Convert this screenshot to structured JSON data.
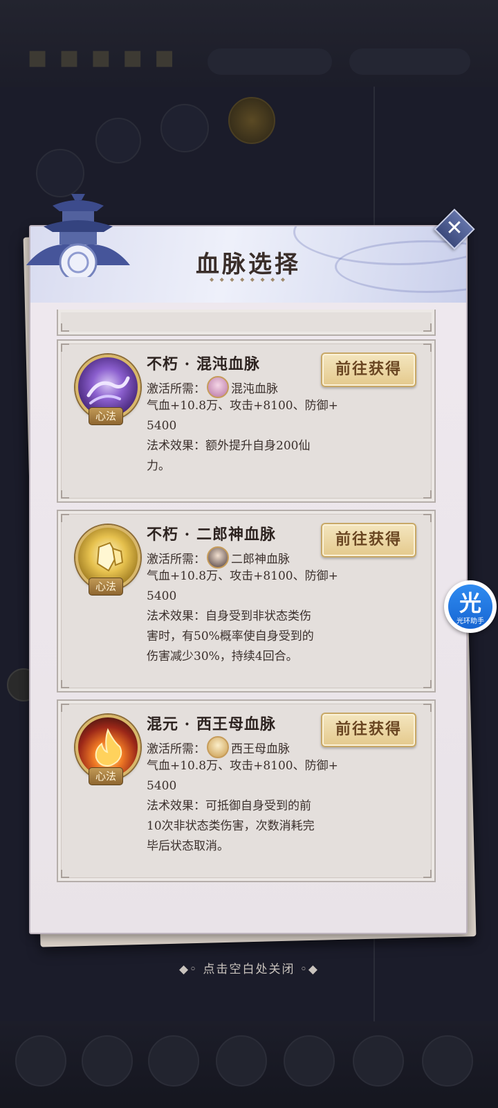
{
  "modal": {
    "title": "血脉选择",
    "close_hint": "点击空白处关闭"
  },
  "bloodlines": [
    {
      "name": "不朽 · 混沌血脉",
      "button": "前往获得",
      "tag": "心法",
      "req_label": "激活所需：",
      "req_item": "混沌血脉",
      "stats_line1": "气血+10.8万、攻击+8100、防御+",
      "stats_line2": "5400",
      "effect_lines": [
        "法术效果：额外提升自身200仙",
        "力。"
      ],
      "emblem_color": "#8b5fce"
    },
    {
      "name": "不朽 · 二郎神血脉",
      "button": "前往获得",
      "tag": "心法",
      "req_label": "激活所需：",
      "req_item": "二郎神血脉",
      "stats_line1": "气血+10.8万、攻击+8100、防御+",
      "stats_line2": "5400",
      "effect_lines": [
        "法术效果：自身受到非状态类伤",
        "害时，有50%概率使自身受到的",
        "伤害减少30%，持续4回合。"
      ],
      "emblem_color": "#e7c24f"
    },
    {
      "name": "混元 · 西王母血脉",
      "button": "前往获得",
      "tag": "心法",
      "req_label": "激活所需：",
      "req_item": "西王母血脉",
      "stats_line1": "气血+10.8万、攻击+8100、防御+",
      "stats_line2": "5400",
      "effect_lines": [
        "法术效果：可抵御自身受到的前",
        "10次非状态类伤害，次数消耗完",
        "毕后状态取消。"
      ],
      "emblem_color": "#f07a25"
    }
  ],
  "helper": {
    "glyph": "光",
    "label": "光环助手"
  }
}
